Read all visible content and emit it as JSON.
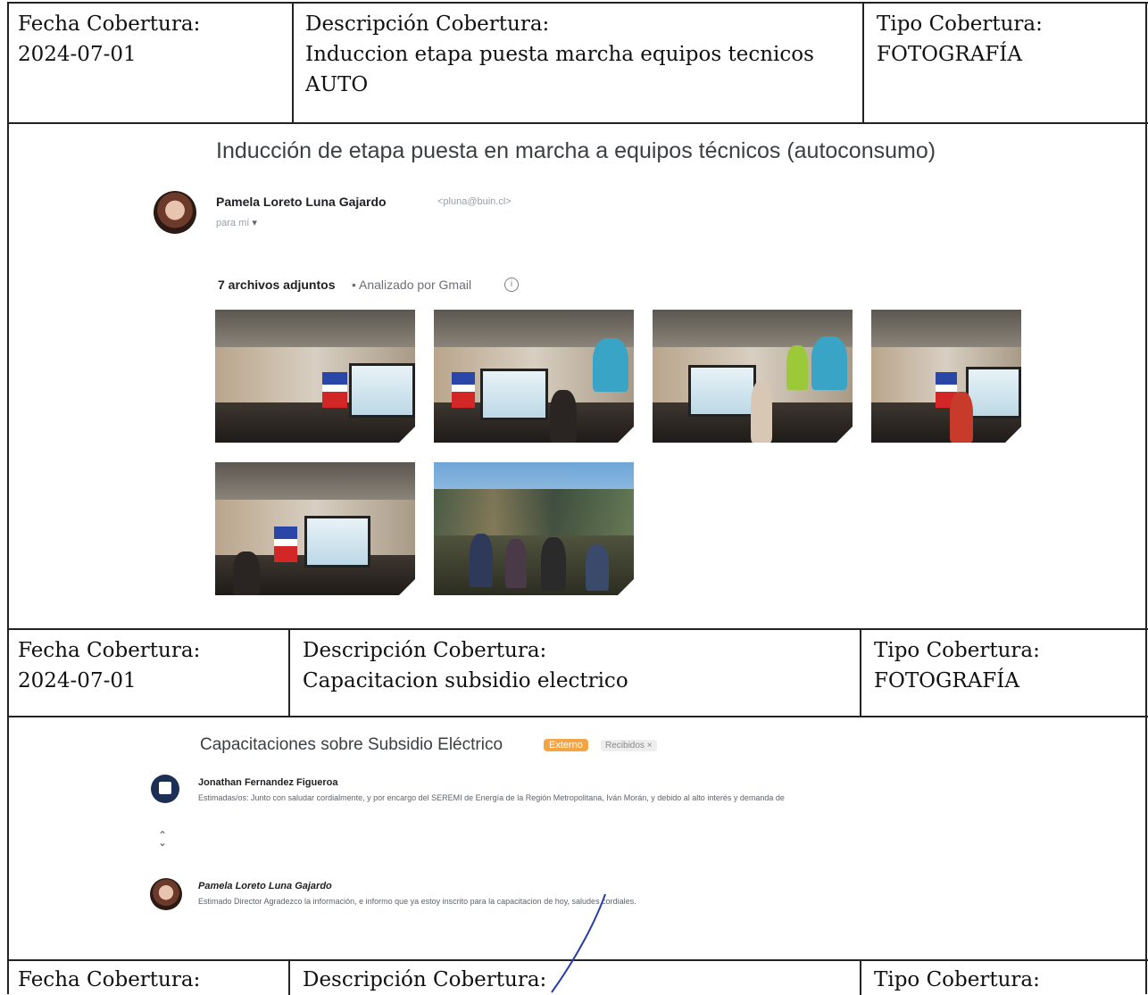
{
  "rows": [
    {
      "fecha_label": "Fecha Cobertura:",
      "fecha_value": "2024-07-01",
      "desc_label": "Descripción Cobertura:",
      "desc_line1": "Induccion etapa puesta marcha equipos tecnicos",
      "desc_line2": "AUTO",
      "tipo_label": "Tipo Cobertura:",
      "tipo_value": "FOTOGRAFÍA"
    },
    {
      "fecha_label": "Fecha Cobertura:",
      "fecha_value": "2024-07-01",
      "desc_label": "Descripción Cobertura:",
      "desc_line1": "Capacitacion subsidio electrico",
      "tipo_label": "Tipo Cobertura:",
      "tipo_value": "FOTOGRAFÍA"
    },
    {
      "fecha_label": "Fecha Cobertura:",
      "desc_label": "Descripción Cobertura:",
      "tipo_label": "Tipo Cobertura:"
    }
  ],
  "email1": {
    "subject": "Inducción de etapa puesta en marcha a equipos técnicos (autoconsumo)",
    "sender_name": "Pamela Loreto Luna Gajardo",
    "sender_email": "<pluna@buin.cl>",
    "to": "para mí",
    "attachments_count": "7 archivos adjuntos",
    "attachments_note": "• Analizado por Gmail",
    "info_icon": "info-icon"
  },
  "email2": {
    "subject": "Capacitaciones sobre Subsidio Eléctrico",
    "badge_external": "Externo",
    "badge_inbox": "Recibidos ×",
    "msg1_sender": "Jonathan Fernandez Figueroa",
    "msg1_snippet": "Estimadas/os: Junto con saludar cordialmente, y por encargo del SEREMI de Energía de la Región Metropolitana, Iván Morán, y debido al alto interés y demanda de",
    "msg2_sender": "Pamela Loreto Luna Gajardo",
    "msg2_snippet": "Estimado Director Agradezco la información, e informo que ya estoy inscrito para la capacitacion de hoy, saludes cordiales."
  },
  "colors": {
    "border": "#222222",
    "badge_external": "#f4a543",
    "pen_stroke": "#2a3ea8"
  }
}
